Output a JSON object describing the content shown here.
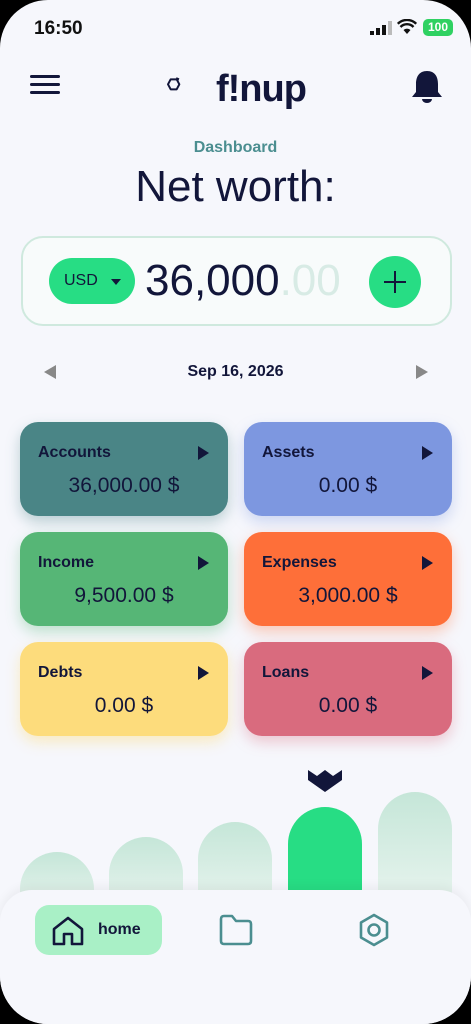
{
  "status": {
    "time": "16:50",
    "battery": "100"
  },
  "header": {
    "brand": "f!nup"
  },
  "page": {
    "subtitle": "Dashboard",
    "title": "Net worth:"
  },
  "networth": {
    "currency": "USD",
    "whole": "36,000",
    "cents": ".00"
  },
  "date_nav": {
    "date": "Sep 16, 2026"
  },
  "tiles": [
    {
      "label": "Accounts",
      "value": "36,000.00 $",
      "color": "#4a8586"
    },
    {
      "label": "Assets",
      "value": "0.00 $",
      "color": "#7d97e0"
    },
    {
      "label": "Income",
      "value": "9,500.00 $",
      "color": "#56b676"
    },
    {
      "label": "Expenses",
      "value": "3,000.00 $",
      "color": "#fe6f39"
    },
    {
      "label": "Debts",
      "value": "0.00 $",
      "color": "#fddc7c"
    },
    {
      "label": "Loans",
      "value": "0.00 $",
      "color": "#d96b7e"
    }
  ],
  "colors": {
    "accent": "#27dd84",
    "dark": "#12163a",
    "teal": "#4b8e90"
  },
  "nav": {
    "home_label": "home"
  }
}
